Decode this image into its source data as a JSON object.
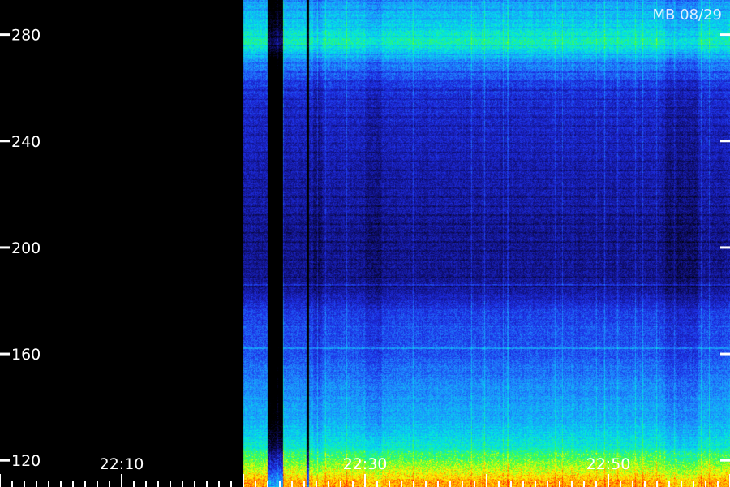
{
  "chart_data": {
    "type": "heatmap",
    "station_label": "MB 08/29",
    "y_ticks": [
      120,
      160,
      200,
      240,
      280
    ],
    "y_tick_labels": [
      "120",
      "160",
      "200",
      "240",
      "280"
    ],
    "ylim": [
      110,
      293
    ],
    "x_ticks": [
      "22:10",
      "22:30",
      "22:50"
    ],
    "xlim_minutes": [
      1320,
      1380
    ],
    "x_tick_minutes": [
      1330,
      1350,
      1370
    ],
    "data_start_minute": 1340,
    "colormap": [
      "#000000",
      "#10107a",
      "#1e2ee6",
      "#1e90ff",
      "#00e6e6",
      "#40ff40",
      "#ffff00",
      "#ff8000",
      "#ff0000"
    ],
    "intensity_profile": [
      {
        "y": 112,
        "level": 0.82
      },
      {
        "y": 118,
        "level": 0.66
      },
      {
        "y": 125,
        "level": 0.52
      },
      {
        "y": 135,
        "level": 0.42
      },
      {
        "y": 150,
        "level": 0.36
      },
      {
        "y": 160,
        "level": 0.3
      },
      {
        "y": 175,
        "level": 0.27
      },
      {
        "y": 185,
        "level": 0.16
      },
      {
        "y": 200,
        "level": 0.15
      },
      {
        "y": 215,
        "level": 0.17
      },
      {
        "y": 230,
        "level": 0.19
      },
      {
        "y": 245,
        "level": 0.21
      },
      {
        "y": 260,
        "level": 0.25
      },
      {
        "y": 270,
        "level": 0.38
      },
      {
        "y": 277,
        "level": 0.55
      },
      {
        "y": 285,
        "level": 0.46
      },
      {
        "y": 293,
        "level": 0.4
      }
    ]
  }
}
